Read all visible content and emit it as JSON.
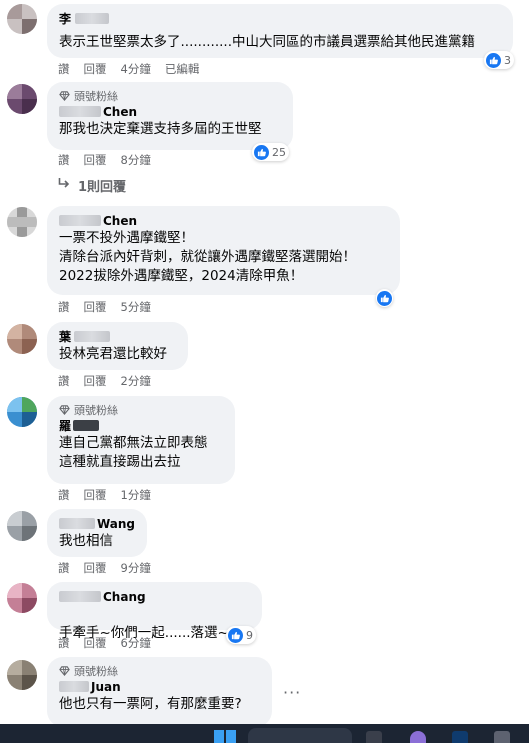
{
  "comments": [
    {
      "name": "李",
      "text": "表示王世堅票太多了............中山大同區的市議員選票給其他民進黨籍",
      "actions": {
        "reply": "讚",
        "reply2": "回覆",
        "time": "4分鐘",
        "edited": "已編輯"
      },
      "reactions": "3"
    },
    {
      "badge": "頭號粉絲",
      "name": "Chen",
      "text": "那我也決定棄選支持多屆的王世堅",
      "actions": {
        "reply": "讚",
        "reply2": "回覆",
        "time": "8分鐘"
      },
      "reactions": "25",
      "replies": "1則回覆"
    },
    {
      "name": "Chen",
      "text": "一票不投外遇摩鐵堅！\n清除台派內奸背刺，就從讓外遇摩鐵堅落選開始！\n2022拔除外遇摩鐵堅，2024清除甲魚！",
      "actions": {
        "reply": "讚",
        "reply2": "回覆",
        "time": "5分鐘"
      }
    },
    {
      "name": "葉",
      "text": "投林亮君還比較好",
      "actions": {
        "reply": "讚",
        "reply2": "回覆",
        "time": "2分鐘"
      }
    },
    {
      "badge": "頭號粉絲",
      "name": "羅",
      "text": "連自己黨都無法立即表態\n這種就直接踢出去拉",
      "actions": {
        "reply": "讚",
        "reply2": "回覆",
        "time": "1分鐘"
      }
    },
    {
      "name": "Wang",
      "text": "我也相信",
      "actions": {
        "reply": "讚",
        "reply2": "回覆",
        "time": "9分鐘"
      }
    },
    {
      "name": "Chang",
      "text": "手牽手~你們一起......落選~",
      "actions": {
        "reply": "讚",
        "reply2": "回覆",
        "time": "6分鐘"
      },
      "reactions": "9"
    },
    {
      "badge": "頭號粉絲",
      "name": "Juan",
      "text": "他也只有一票阿，有那麼重要?",
      "more": "···"
    }
  ],
  "icons": {
    "like": "thumbs-up-icon",
    "haha": "laughing-emoji-icon",
    "fan": "diamond-badge-icon",
    "reply_arrow": "reply-arrow-icon",
    "more": "more-options-icon"
  },
  "colors": {
    "bubble": "#f0f2f5",
    "like": "#1877f2",
    "meta": "#65676b",
    "taskbar": "#1c2533"
  }
}
